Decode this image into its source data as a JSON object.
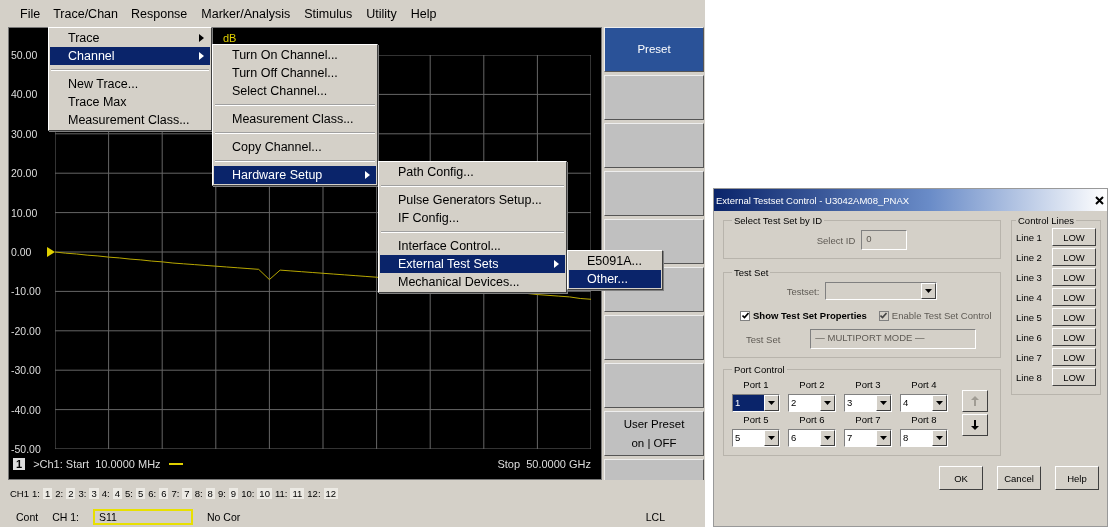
{
  "menu_bar": [
    {
      "label": "File",
      "selected": false
    },
    {
      "label": "Trace/Chan",
      "selected": true
    },
    {
      "label": "Response",
      "selected": false
    },
    {
      "label": "Marker/Analysis",
      "selected": false
    },
    {
      "label": "Stimulus",
      "selected": false
    },
    {
      "label": "Utility",
      "selected": false
    },
    {
      "label": "Help",
      "selected": false
    }
  ],
  "menus": [
    {
      "items": [
        {
          "kind": "item",
          "label": "Trace",
          "submenu": true,
          "selected": false
        },
        {
          "kind": "item",
          "label": "Channel",
          "submenu": true,
          "selected": true
        },
        {
          "kind": "separator"
        },
        {
          "kind": "item",
          "label": "New Trace...",
          "submenu": false,
          "selected": false
        },
        {
          "kind": "item",
          "label": "Trace Max",
          "submenu": false,
          "selected": false
        },
        {
          "kind": "item",
          "label": "Measurement Class...",
          "submenu": false,
          "selected": false
        }
      ]
    },
    {
      "items": [
        {
          "kind": "item",
          "label": "Turn On Channel...",
          "submenu": false,
          "selected": false
        },
        {
          "kind": "item",
          "label": "Turn Off Channel...",
          "submenu": false,
          "selected": false
        },
        {
          "kind": "item",
          "label": "Select Channel...",
          "submenu": false,
          "selected": false
        },
        {
          "kind": "separator"
        },
        {
          "kind": "item",
          "label": "Measurement Class...",
          "submenu": false,
          "selected": false
        },
        {
          "kind": "separator"
        },
        {
          "kind": "item",
          "label": "Copy Channel...",
          "submenu": false,
          "selected": false
        },
        {
          "kind": "separator"
        },
        {
          "kind": "item",
          "label": "Hardware Setup",
          "submenu": true,
          "selected": true
        }
      ]
    },
    {
      "items": [
        {
          "kind": "item",
          "label": "Path Config...",
          "submenu": false,
          "selected": false
        },
        {
          "kind": "separator"
        },
        {
          "kind": "item",
          "label": "Pulse Generators Setup...",
          "submenu": false,
          "selected": false
        },
        {
          "kind": "item",
          "label": "IF Config...",
          "submenu": false,
          "selected": false
        },
        {
          "kind": "separator"
        },
        {
          "kind": "item",
          "label": "Interface Control...",
          "submenu": false,
          "selected": false
        },
        {
          "kind": "item",
          "label": "External Test Sets",
          "submenu": true,
          "selected": true
        },
        {
          "kind": "item",
          "label": "Mechanical Devices...",
          "submenu": false,
          "selected": false
        }
      ]
    },
    {
      "items": [
        {
          "kind": "item",
          "label": "E5091A...",
          "submenu": false,
          "selected": false
        },
        {
          "kind": "item",
          "label": "Other...",
          "submenu": false,
          "selected": true
        }
      ]
    }
  ],
  "chart": {
    "channel_number": "1",
    "start": ">Ch1: Start  10.0000 MHz",
    "stop": "Stop  50.0000 GHz",
    "chart_data": {
      "type": "line",
      "ylabel": "dB",
      "grid": true,
      "categories": [
        null,
        null,
        null,
        null,
        null,
        null,
        null,
        null,
        null,
        null,
        null,
        null,
        null,
        null,
        null,
        null,
        null,
        null,
        null,
        null,
        null,
        null,
        null,
        null,
        null,
        null,
        null,
        null,
        null,
        null,
        null,
        null,
        null,
        null,
        null,
        null,
        null,
        null,
        null,
        null,
        null,
        null,
        null,
        null,
        null,
        null,
        null,
        null,
        null,
        null,
        null
      ],
      "ylim": [
        -50,
        50
      ],
      "yticks": [
        {
          "value": 50,
          "label": "50.00"
        },
        {
          "value": 40,
          "label": "40.00"
        },
        {
          "value": 30,
          "label": "30.00"
        },
        {
          "value": 20,
          "label": "20.00"
        },
        {
          "value": 10,
          "label": "10.00"
        },
        {
          "value": 0,
          "label": "0.00"
        },
        {
          "value": -10,
          "label": "-10.00"
        },
        {
          "value": -20,
          "label": "-20.00"
        },
        {
          "value": -30,
          "label": "-30.00"
        },
        {
          "value": -40,
          "label": "-40.00"
        },
        {
          "value": -50,
          "label": "-50.00"
        }
      ],
      "series": [
        {
          "color": "#b8a800",
          "values": [
            0,
            -0.3,
            -0.5,
            -0.8,
            -1.0,
            -1.3,
            -1.5,
            -1.8,
            -2.0,
            -2.3,
            -2.5,
            -2.8,
            -3.0,
            -3.2,
            -3.4,
            -3.6,
            -3.8,
            -4.0,
            -4.2,
            -4.4,
            -7.0,
            -4.6,
            -4.8,
            -5.0,
            -5.2,
            -5.4,
            -5.6,
            -5.8,
            -6.0,
            -6.2,
            -6.4,
            null,
            null,
            null,
            null,
            null,
            null,
            null,
            null,
            null,
            null,
            null,
            null,
            null,
            null,
            -10.8,
            null,
            -11.2,
            -11.4,
            -11.8,
            -12.0
          ]
        }
      ]
    }
  },
  "softkeys": [
    {
      "label": "Preset",
      "selected": true
    },
    {
      "selected": false
    },
    {
      "selected": false
    },
    {
      "selected": false
    },
    {
      "selected": false
    },
    {
      "selected": false
    },
    {
      "selected": false
    },
    {
      "selected": false
    },
    {
      "label": "User Preset",
      "sublabel": "on | OFF",
      "selected": false
    },
    {
      "selected": false
    }
  ],
  "channel_tabs": {
    "prefix": "CH1",
    "items": [
      {
        "num": "1:",
        "label": "1"
      },
      {
        "num": "2:",
        "label": "2"
      },
      {
        "num": "3:",
        "label": "3"
      },
      {
        "num": "4:",
        "label": "4"
      },
      {
        "num": "5:",
        "label": "5"
      },
      {
        "num": "6:",
        "label": "6"
      },
      {
        "num": "7:",
        "label": "7"
      },
      {
        "num": "8:",
        "label": "8"
      },
      {
        "num": "9:",
        "label": "9"
      },
      {
        "num": "10:",
        "label": "10"
      },
      {
        "num": "11:",
        "label": "11"
      },
      {
        "num": "12:",
        "label": "12"
      }
    ]
  },
  "status_bar": [
    {
      "kind": "text",
      "label": "Cont"
    },
    {
      "kind": "text",
      "label": "CH 1:"
    },
    {
      "kind": "field",
      "label": "S11"
    },
    {
      "kind": "text",
      "label": "No Cor"
    },
    {
      "kind": "right",
      "label": "LCL"
    }
  ],
  "dialog": {
    "title": "External Testset Control - U3042AM08_PNAX",
    "select_by_id": {
      "title": "Select Test Set by ID",
      "label": "Select ID",
      "value": "0",
      "disabled": true
    },
    "test_set": {
      "title": "Test Set",
      "testset_label": "Testset:",
      "testset_disabled": true,
      "checkboxes": [
        {
          "label": "Show Test Set Properties",
          "checked": true,
          "disabled": false
        },
        {
          "label": "Enable Test Set Control",
          "checked": true,
          "disabled": true
        }
      ],
      "mode_label": "Test Set",
      "mode_value": "— MULTIPORT MODE —",
      "mode_disabled": true
    },
    "control_lines": {
      "title": "Control Lines",
      "lines": [
        {
          "label": "Line 1",
          "value": "LOW"
        },
        {
          "label": "Line 2",
          "value": "LOW"
        },
        {
          "label": "Line 3",
          "value": "LOW"
        },
        {
          "label": "Line 4",
          "value": "LOW"
        },
        {
          "label": "Line 5",
          "value": "LOW"
        },
        {
          "label": "Line 6",
          "value": "LOW"
        },
        {
          "label": "Line 7",
          "value": "LOW"
        },
        {
          "label": "Line 8",
          "value": "LOW"
        }
      ]
    },
    "port_control": {
      "title": "Port Control",
      "ports": [
        {
          "label": "Port 1",
          "value": "1",
          "selected": true
        },
        {
          "label": "Port 2",
          "value": "2",
          "selected": false
        },
        {
          "label": "Port 3",
          "value": "3",
          "selected": false
        },
        {
          "label": "Port 4",
          "value": "4",
          "selected": false
        },
        {
          "label": "Port 5",
          "value": "5",
          "selected": false
        },
        {
          "label": "Port 6",
          "value": "6",
          "selected": false
        },
        {
          "label": "Port 7",
          "value": "7",
          "selected": false
        },
        {
          "label": "Port 8",
          "value": "8",
          "selected": false
        }
      ],
      "up_disabled": true,
      "down_disabled": false
    },
    "buttons": [
      "OK",
      "Cancel",
      "Help"
    ]
  }
}
